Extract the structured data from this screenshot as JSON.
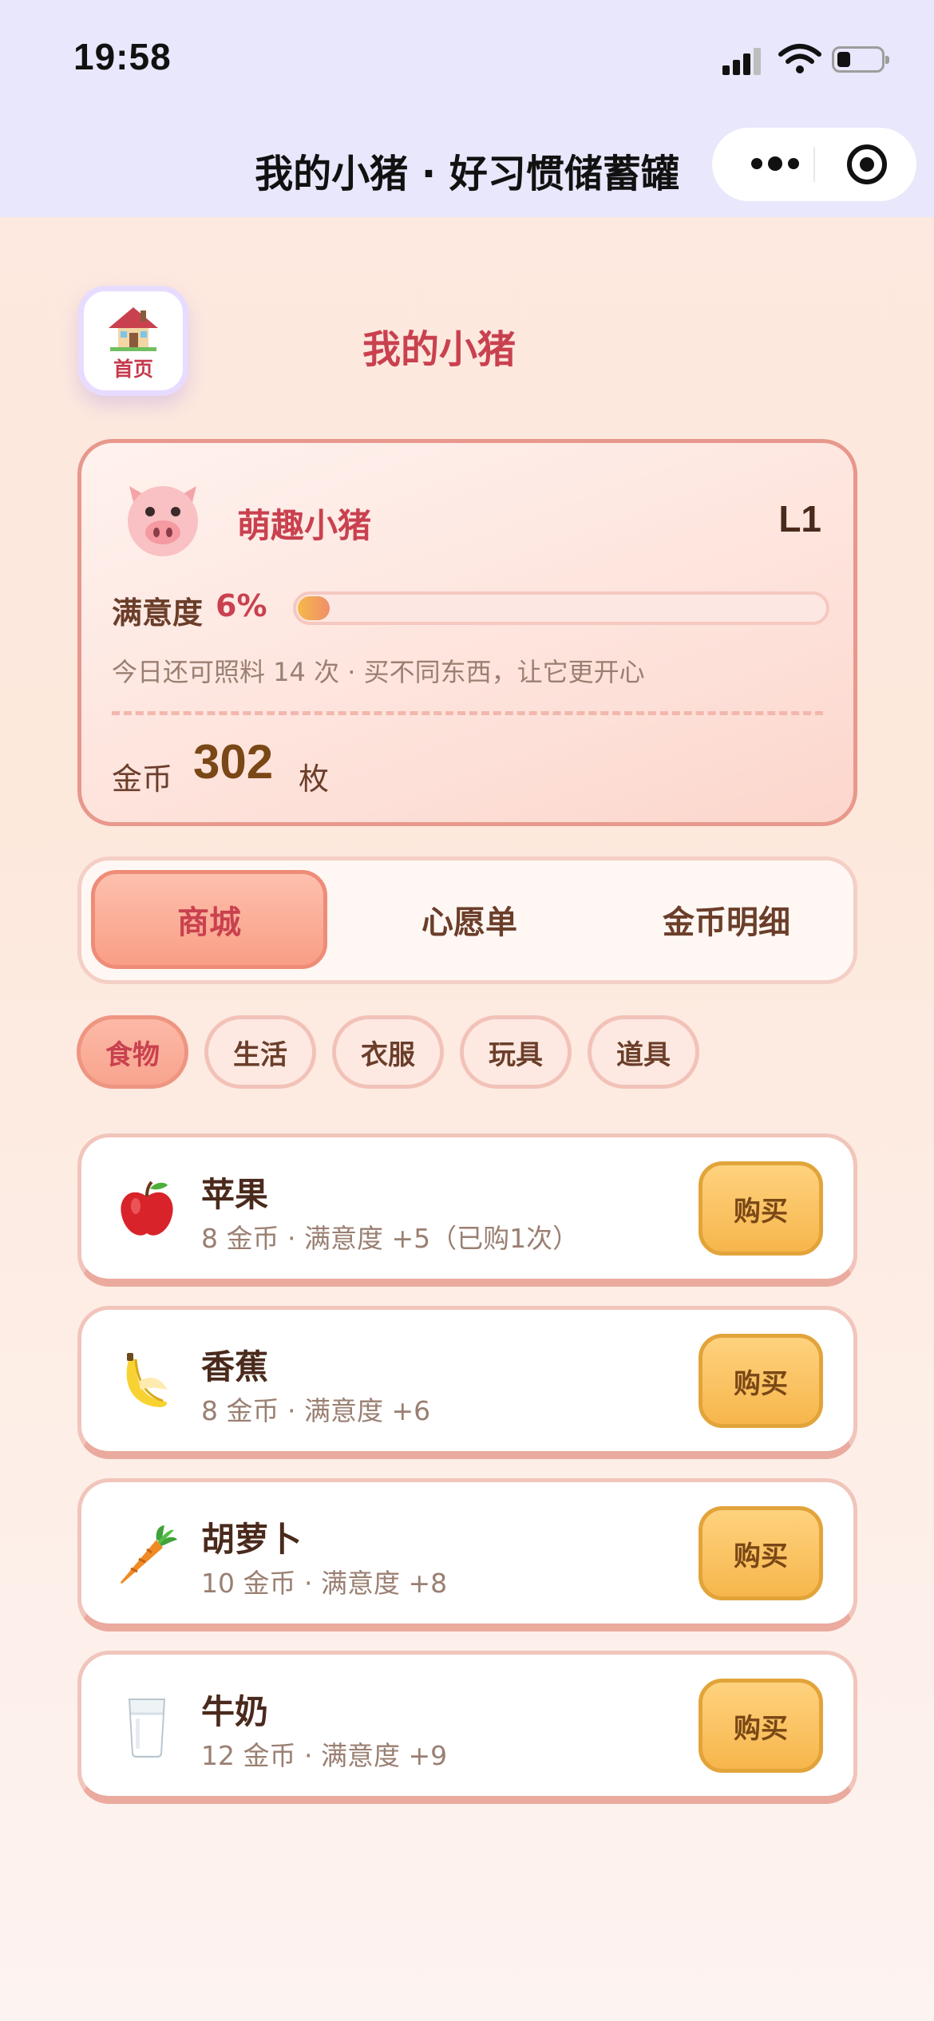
{
  "status_bar": {
    "time": "19:58"
  },
  "nav": {
    "title": "我的小猪 · 好习惯储蓄罐"
  },
  "header": {
    "home_label": "首页",
    "page_title": "我的小猪"
  },
  "pig": {
    "name": "萌趣小猪",
    "level": "L1",
    "satisfaction_label": "满意度",
    "satisfaction_value": "6%",
    "satisfaction_fraction": 0.06,
    "care_hint": "今日还可照料 14 次 · 买不同东西，让它更开心",
    "coins_label": "金币",
    "coins_value": "302",
    "coins_unit": "枚"
  },
  "main_tabs": [
    {
      "label": "商城",
      "active": true
    },
    {
      "label": "心愿单",
      "active": false
    },
    {
      "label": "金币明细",
      "active": false
    }
  ],
  "categories": [
    {
      "label": "食物",
      "active": true
    },
    {
      "label": "生活",
      "active": false
    },
    {
      "label": "衣服",
      "active": false
    },
    {
      "label": "玩具",
      "active": false
    },
    {
      "label": "道具",
      "active": false
    }
  ],
  "items": [
    {
      "icon": "apple-icon",
      "name": "苹果",
      "desc": "8 金币 · 满意度 +5（已购1次）",
      "buy_label": "购买"
    },
    {
      "icon": "banana-icon",
      "name": "香蕉",
      "desc": "8 金币 · 满意度 +6",
      "buy_label": "购买"
    },
    {
      "icon": "carrot-icon",
      "name": "胡萝卜",
      "desc": "10 金币 · 满意度 +8",
      "buy_label": "购买"
    },
    {
      "icon": "milk-icon",
      "name": "牛奶",
      "desc": "12 金币 · 满意度 +9",
      "buy_label": "购买"
    }
  ],
  "colors": {
    "accent": "#c9414f",
    "card_border": "#e8988c",
    "buy_button": "#f7b64c",
    "nav_background": "#e8e7fb"
  }
}
